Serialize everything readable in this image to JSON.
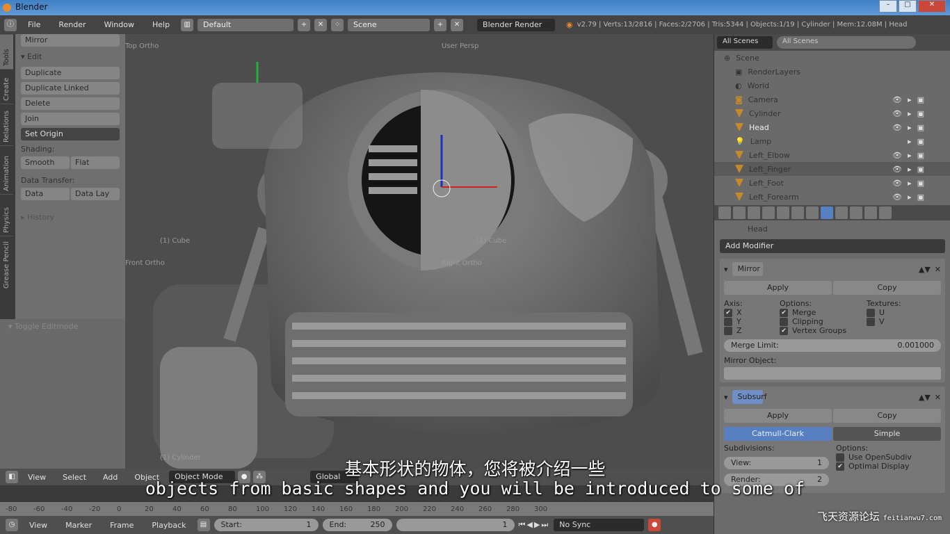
{
  "window": {
    "title": "Blender"
  },
  "info_header": {
    "menus": [
      "File",
      "Render",
      "Window",
      "Help"
    ],
    "screen_layout": "Default",
    "scene": "Scene",
    "render_engine": "Blender Render",
    "stats": "v2.79 | Verts:13/2816 | Faces:2/2706 | Tris:5344 | Objects:1/19 | Cylinder | Mem:12.08M | Head"
  },
  "tool_tabs": [
    "Tools",
    "Create",
    "Relations",
    "Animation",
    "Physics",
    "Grease Pencil"
  ],
  "tool_panel": {
    "mirror": "Mirror",
    "edit": "▾ Edit",
    "buttons": [
      "Duplicate",
      "Duplicate Linked",
      "Delete",
      "Join"
    ],
    "set_origin": "Set Origin",
    "shading": "Shading:",
    "smooth": "Smooth",
    "flat": "Flat",
    "data_transfer": "Data Transfer:",
    "data": "Data",
    "data_layout": "Data Lay",
    "history": "▸ History",
    "toggle_editmode": "▾ Toggle Editmode"
  },
  "viewport": {
    "labels": {
      "top_ortho": "Top Ortho",
      "user_persp": "User Persp",
      "front_ortho": "Front Ortho",
      "right_ortho": "Right Ortho",
      "cube1": "(1) Cube",
      "cube2": "(1) Cube",
      "cube3": "(1) Cylinder"
    }
  },
  "outliner": {
    "filter": "All Scenes",
    "search_placeholder": "All Scenes",
    "items": [
      {
        "name": "Scene",
        "type": "scene"
      },
      {
        "name": "RenderLayers",
        "type": "render"
      },
      {
        "name": "World",
        "type": "world"
      },
      {
        "name": "Camera",
        "type": "camera"
      },
      {
        "name": "Cylinder",
        "type": "mesh"
      },
      {
        "name": "Head",
        "type": "mesh"
      },
      {
        "name": "Lamp",
        "type": "lamp"
      },
      {
        "name": "Left_Elbow",
        "type": "mesh"
      },
      {
        "name": "Left_Finger",
        "type": "mesh"
      },
      {
        "name": "Left_Foot",
        "type": "mesh"
      },
      {
        "name": "Left_Forearm",
        "type": "mesh"
      }
    ]
  },
  "properties": {
    "object": "Head",
    "add_modifier": "Add Modifier",
    "mirror_modifier": {
      "name": "Mirror",
      "apply": "Apply",
      "copy": "Copy",
      "axis_label": "Axis:",
      "axes": [
        {
          "label": "X",
          "checked": true
        },
        {
          "label": "Y",
          "checked": false
        },
        {
          "label": "Z",
          "checked": false
        }
      ],
      "options_label": "Options:",
      "options": [
        {
          "label": "Merge",
          "checked": true
        },
        {
          "label": "Clipping",
          "checked": false
        },
        {
          "label": "Vertex Groups",
          "checked": true
        }
      ],
      "textures_label": "Textures:",
      "textures": [
        {
          "label": "U",
          "checked": false
        },
        {
          "label": "V",
          "checked": false
        }
      ],
      "merge_limit_label": "Merge Limit:",
      "merge_limit": "0.001000",
      "mirror_object_label": "Mirror Object:"
    },
    "subsurf_modifier": {
      "name": "Subsurf",
      "apply": "Apply",
      "copy": "Copy",
      "catmull": "Catmull-Clark",
      "simple": "Simple",
      "subdivisions_label": "Subdivisions:",
      "view": "View:",
      "view_value": "1",
      "render": "Render:",
      "render_value": "2",
      "options": "Options:",
      "opt1": "Use OpenSubdiv",
      "opt2": "Optimal Display"
    }
  },
  "header_3d": {
    "menus": [
      "View",
      "Select",
      "Add",
      "Object"
    ],
    "mode": "Object Mode",
    "orientation": "Global"
  },
  "timeline": {
    "ruler": [
      "-80",
      "-60",
      "-40",
      "-20",
      "0",
      "20",
      "40",
      "60",
      "80",
      "100",
      "120",
      "140",
      "160",
      "180",
      "200",
      "220",
      "240",
      "260",
      "280",
      "300"
    ],
    "menus": [
      "View",
      "Marker",
      "Frame",
      "Playback"
    ],
    "start_label": "Start:",
    "start": "1",
    "end_label": "End:",
    "end": "250",
    "current": "1",
    "sync": "No Sync"
  },
  "subtitles": {
    "zh": "基本形状的物体，您将被介绍一些",
    "en": "objects from basic shapes and you will be introduced to some of"
  },
  "watermark": {
    "zh": "飞天资源论坛",
    "url": "feitianwu7.com"
  },
  "colors": {
    "accent": "#5680c2",
    "object_orange": "#e88b2a",
    "background": "#4d4d4d"
  }
}
